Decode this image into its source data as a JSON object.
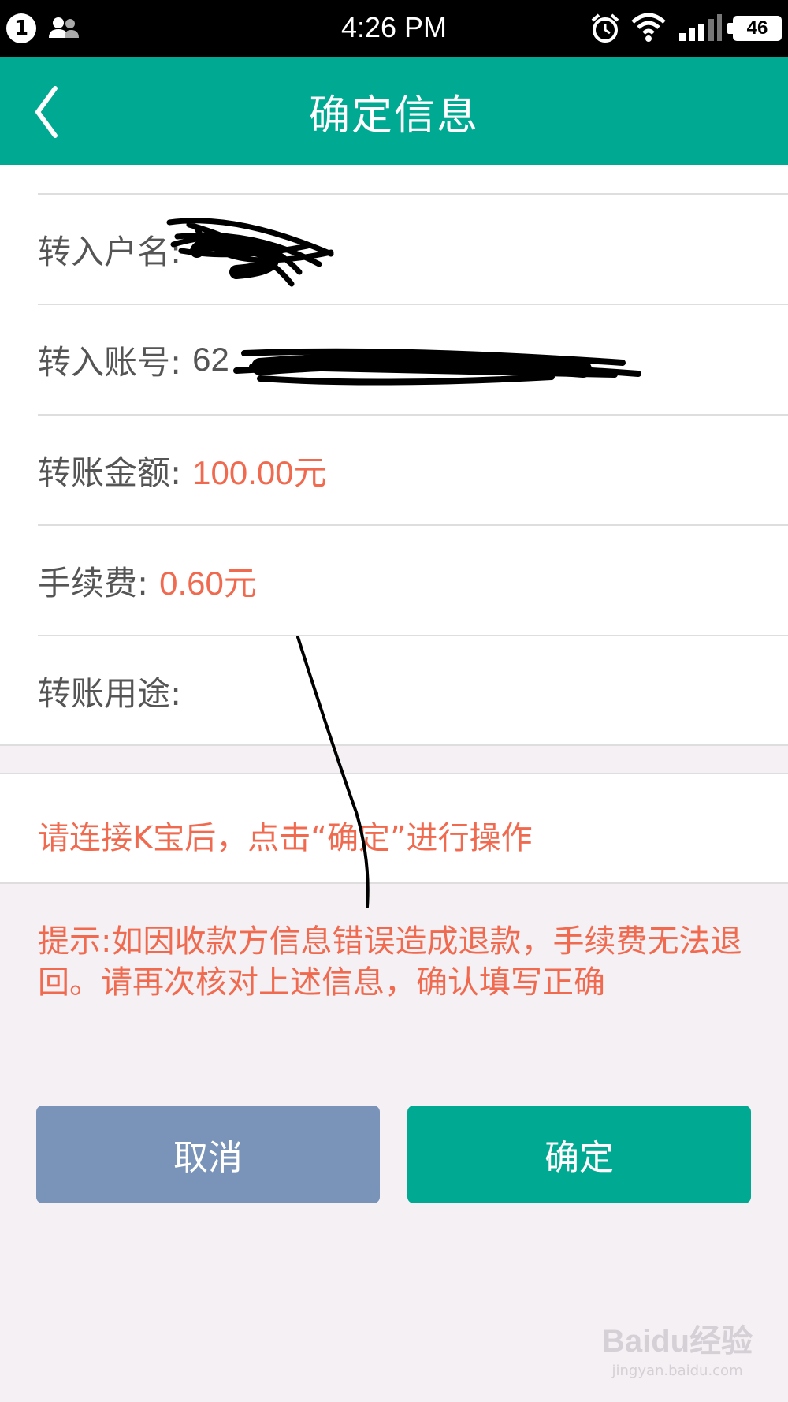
{
  "status_bar": {
    "notification_count": "1",
    "time": "4:26 PM",
    "battery": "46",
    "icons": [
      "people-icon",
      "alarm-icon",
      "wifi-icon",
      "signal-icon",
      "battery-icon"
    ]
  },
  "header": {
    "title": "确定信息",
    "back_icon": "chevron-left-icon",
    "background": "#00a991"
  },
  "form": {
    "rows": [
      {
        "label": "转入户名:",
        "value": ""
      },
      {
        "label": "转入账号:",
        "value": "62"
      },
      {
        "label": "转账金额:",
        "value": "100.00元"
      },
      {
        "label": "手续费:",
        "value": "0.60元"
      },
      {
        "label": "转账用途:",
        "value": ""
      }
    ]
  },
  "notice": "请连接K宝后，点击“确定”进行操作",
  "tip": "提示:如因收款方信息错误造成退款，手续费无法退回。请再次核对上述信息，确认填写正确",
  "buttons": {
    "cancel": "取消",
    "confirm": "确定"
  },
  "watermark": {
    "brand": "Baidu经验",
    "url": "jingyan.baidu.com"
  },
  "colors": {
    "accent": "#00a991",
    "highlight": "#f06a4f",
    "cancel": "#7994b8"
  }
}
